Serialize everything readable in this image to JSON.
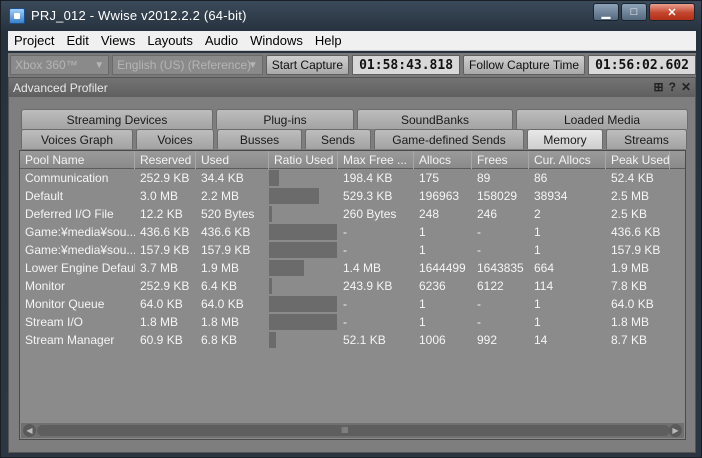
{
  "window": {
    "title": "PRJ_012 - Wwise v2012.2.2 (64-bit)"
  },
  "window_controls": {
    "minimize": "▁",
    "maximize": "□",
    "close": "✕"
  },
  "menu": [
    "Project",
    "Edit",
    "Views",
    "Layouts",
    "Audio",
    "Windows",
    "Help"
  ],
  "toolbar": {
    "platform": "Xbox 360™",
    "language": "English (US) (Reference)",
    "start_capture_label": "Start Capture",
    "capture_time": "01:58:43.818",
    "follow_label": "Follow Capture Time",
    "follow_time": "01:56:02.602"
  },
  "panel": {
    "title": "Advanced Profiler",
    "tabs_row1": [
      "Streaming Devices",
      "Plug-ins",
      "SoundBanks",
      "Loaded Media"
    ],
    "tabs_row2": [
      "Voices Graph",
      "Voices",
      "Busses",
      "Sends",
      "Game-defined Sends",
      "Memory",
      "Streams"
    ],
    "active_tab": "Memory"
  },
  "table": {
    "columns": [
      "Pool Name",
      "Reserved",
      "Used",
      "Ratio Used",
      "Max Free ...",
      "Allocs",
      "Frees",
      "Cur. Allocs",
      "Peak Used"
    ],
    "rows": [
      {
        "name": "Communication",
        "reserved": "252.9 KB",
        "used": "34.4 KB",
        "ratio": 0.14,
        "max_free": "198.4 KB",
        "allocs": "175",
        "frees": "89",
        "cur_allocs": "86",
        "peak": "52.4 KB"
      },
      {
        "name": "Default",
        "reserved": "3.0 MB",
        "used": "2.2 MB",
        "ratio": 0.73,
        "max_free": "529.3 KB",
        "allocs": "196963",
        "frees": "158029",
        "cur_allocs": "38934",
        "peak": "2.5 MB"
      },
      {
        "name": "Deferred I/O File",
        "reserved": "12.2 KB",
        "used": "520 Bytes",
        "ratio": 0.04,
        "max_free": "260 Bytes",
        "allocs": "248",
        "frees": "246",
        "cur_allocs": "2",
        "peak": "2.5 KB"
      },
      {
        "name": "Game:¥media¥sou...",
        "reserved": "436.6 KB",
        "used": "436.6 KB",
        "ratio": 1.0,
        "max_free": "-",
        "allocs": "1",
        "frees": "-",
        "cur_allocs": "1",
        "peak": "436.6 KB"
      },
      {
        "name": "Game:¥media¥sou...",
        "reserved": "157.9 KB",
        "used": "157.9 KB",
        "ratio": 1.0,
        "max_free": "-",
        "allocs": "1",
        "frees": "-",
        "cur_allocs": "1",
        "peak": "157.9 KB"
      },
      {
        "name": "Lower Engine Default",
        "reserved": "3.7 MB",
        "used": "1.9 MB",
        "ratio": 0.51,
        "max_free": "1.4 MB",
        "allocs": "1644499",
        "frees": "1643835",
        "cur_allocs": "664",
        "peak": "1.9 MB"
      },
      {
        "name": "Monitor",
        "reserved": "252.9 KB",
        "used": "6.4 KB",
        "ratio": 0.03,
        "max_free": "243.9 KB",
        "allocs": "6236",
        "frees": "6122",
        "cur_allocs": "114",
        "peak": "7.8 KB"
      },
      {
        "name": "Monitor Queue",
        "reserved": "64.0 KB",
        "used": "64.0 KB",
        "ratio": 1.0,
        "max_free": "-",
        "allocs": "1",
        "frees": "-",
        "cur_allocs": "1",
        "peak": "64.0 KB"
      },
      {
        "name": "Stream I/O",
        "reserved": "1.8 MB",
        "used": "1.8 MB",
        "ratio": 1.0,
        "max_free": "-",
        "allocs": "1",
        "frees": "-",
        "cur_allocs": "1",
        "peak": "1.8 MB"
      },
      {
        "name": "Stream Manager",
        "reserved": "60.9 KB",
        "used": "6.8 KB",
        "ratio": 0.11,
        "max_free": "52.1 KB",
        "allocs": "1006",
        "frees": "992",
        "cur_allocs": "14",
        "peak": "8.7 KB"
      }
    ]
  },
  "icons": {
    "panel_grid": "grid-icon",
    "panel_help": "help-icon",
    "panel_close": "close-icon"
  },
  "colors": {
    "panel_bg": "#7e7e7e",
    "grid_bg": "#8b8b8b",
    "ratio_bar": "#6b6b6b",
    "menu_bg": "#f0f0f0"
  }
}
